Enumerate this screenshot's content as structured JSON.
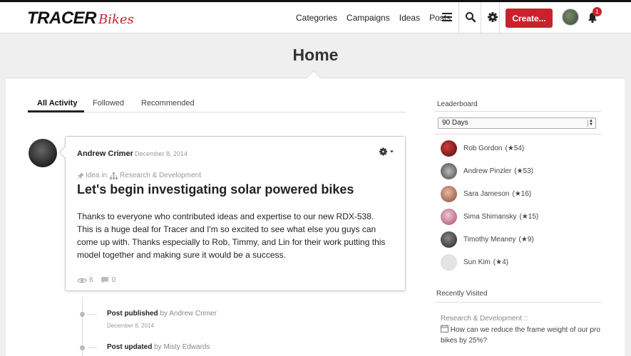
{
  "brand": {
    "main": "TRACER",
    "sub": "Bikes",
    "accent": "#c8232c"
  },
  "nav": {
    "links": [
      "Categories",
      "Campaigns",
      "Ideas",
      "Posts"
    ],
    "create_label": "Create...",
    "notification_count": "1"
  },
  "page": {
    "title": "Home"
  },
  "tabs": [
    "All Activity",
    "Followed",
    "Recommended"
  ],
  "post": {
    "author": "Andrew Crimer",
    "date": "December 8, 2014",
    "type_label": "Idea in",
    "category": "Research & Development",
    "title": "Let's begin investigating solar powered bikes",
    "body": "Thanks to everyone who contributed ideas and expertise to our new RDX-538. This is a huge deal for Tracer and I'm so excited to see what else you guys can come up with. Thanks especially to Rob, Timmy, and Lin for their work putting this model together and making sure it would be a success.",
    "views": "6",
    "comments": "0"
  },
  "timeline": [
    {
      "action": "Post published",
      "by": "by Andrew Crimer",
      "date": "December 8, 2014"
    },
    {
      "action": "Post updated",
      "by": "by Misty Edwards",
      "date": ""
    }
  ],
  "leaderboard": {
    "heading": "Leaderboard",
    "period": "90 Days",
    "entries": [
      {
        "name": "Rob Gordon",
        "score": "(★54)"
      },
      {
        "name": "Andrew Pinzler",
        "score": "(★53)"
      },
      {
        "name": "Sara Jameson",
        "score": "(★16)"
      },
      {
        "name": "Sima Shimansky",
        "score": "(★15)"
      },
      {
        "name": "Timothy Meaney",
        "score": "(★9)"
      },
      {
        "name": "Sun Kim",
        "score": "(★4)"
      }
    ]
  },
  "recent": {
    "heading": "Recently Visited",
    "category": "Research & Development ::",
    "item": "How can we reduce the frame weight of our pro bikes by 25%?"
  }
}
